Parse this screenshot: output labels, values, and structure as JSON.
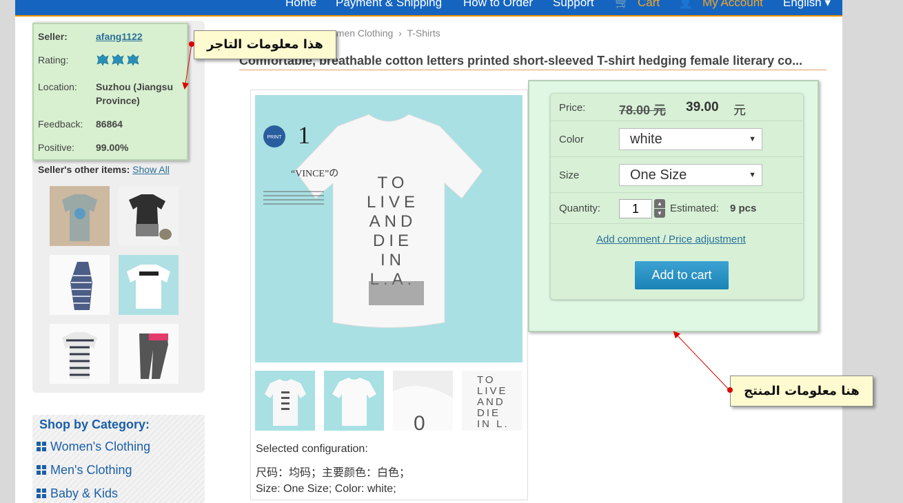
{
  "nav": {
    "home": "Home",
    "payment": "Payment & Shipping",
    "how_to_order": "How to Order",
    "support": "Support",
    "cart": "Cart",
    "account": "My Account",
    "language": "English ▾"
  },
  "seller": {
    "seller_label": "Seller:",
    "seller_value": "afang1122",
    "rating_label": "Rating:",
    "location_label": "Location:",
    "location_value_line1": "Suzhou (Jiangsu",
    "location_value_line2": "Province)",
    "feedback_label": "Feedback:",
    "feedback_value": "86864",
    "positive_label": "Positive:",
    "positive_value": "99.00%",
    "other_items_label": "Seller's other items:",
    "show_all": "Show All"
  },
  "categories": {
    "title": "Shop by Category:",
    "items": [
      "Women's Clothing",
      "Men's Clothing",
      "Baby & Kids"
    ]
  },
  "breadcrumb": {
    "level1": "omen Clothing",
    "sep": "›",
    "level2": "T-Shirts"
  },
  "product": {
    "title": "Comfortable, breathable cotton letters printed short-sleeved T-shirt hedging female literary co...",
    "shirt_print": "TO LIVE AND DIE IN L.A.",
    "config_label": "Selected configuration:",
    "config_cn": "尺码：均码；主要颜色：白色；",
    "config_en": "Size: One Size; Color: white;"
  },
  "order_form": {
    "price_label": "Price:",
    "old_price": "78.00 元",
    "new_price": "39.00",
    "currency": "元",
    "color_label": "Color",
    "color_value": "white",
    "size_label": "Size",
    "size_value": "One Size",
    "quantity_label": "Quantity:",
    "quantity_value": "1",
    "estimated_label": "Estimated:",
    "estimated_value": "9 pcs",
    "comment_link": "Add comment / Price adjustment",
    "add_to_cart": "Add to cart"
  },
  "annotations": {
    "seller_info": "هذا معلومات التاجر",
    "product_info": "هنا معلومات المنتج"
  },
  "colors": {
    "brand_blue": "#1565c0",
    "accent_orange": "#f39200",
    "link_blue": "#2a6f97",
    "button_blue": "#2a93c6"
  }
}
